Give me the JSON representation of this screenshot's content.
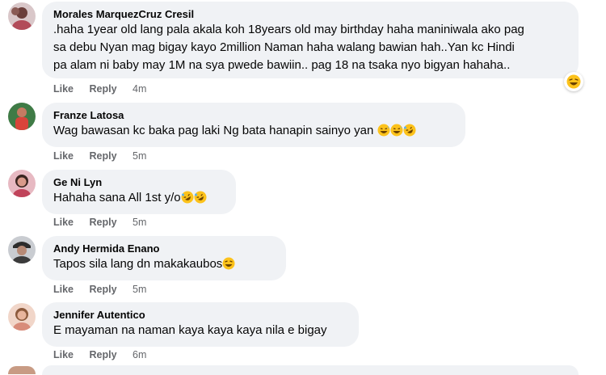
{
  "comments": [
    {
      "author": "Morales MarquezCruz Cresil",
      "text": ".haha 1year old lang pala akala koh 18years old may birthday haha maniniwala ako pag\nsa debu Nyan mag bigay kayo 2million Naman haha walang bawian hah..Yan kc Hindi\npa alam ni baby may 1M na sya pwede bawiin.. pag 18 na tsaka nyo bigyan hahaha..",
      "like": "Like",
      "reply": "Reply",
      "time": "4m",
      "reaction_icon": "laughing-face-icon"
    },
    {
      "author": "Franze Latosa",
      "text": "Wag bawasan kc baka pag laki Ng bata hanapin sainyo yan",
      "like": "Like",
      "reply": "Reply",
      "time": "5m",
      "emoji_icons": [
        "grinning-sweat-icon",
        "grinning-sweat-icon",
        "rofl-icon"
      ]
    },
    {
      "author": "Ge Ni Lyn",
      "text": "Hahaha sana All 1st y/o",
      "like": "Like",
      "reply": "Reply",
      "time": "5m",
      "emoji_icons": [
        "rofl-icon",
        "rofl-icon"
      ]
    },
    {
      "author": "Andy Hermida Enano",
      "text": "Tapos sila lang dn makakaubos",
      "like": "Like",
      "reply": "Reply",
      "time": "5m",
      "emoji_icons": [
        "laughing-face-icon"
      ]
    },
    {
      "author": "Jennifer Autentico",
      "text": "E mayaman na naman kaya kaya kaya nila e bigay",
      "like": "Like",
      "reply": "Reply",
      "time": "6m"
    }
  ],
  "colors": {
    "bubble": "#f0f2f5",
    "meta_text": "#65676b",
    "emoji_yellow": "#fcc21b"
  }
}
